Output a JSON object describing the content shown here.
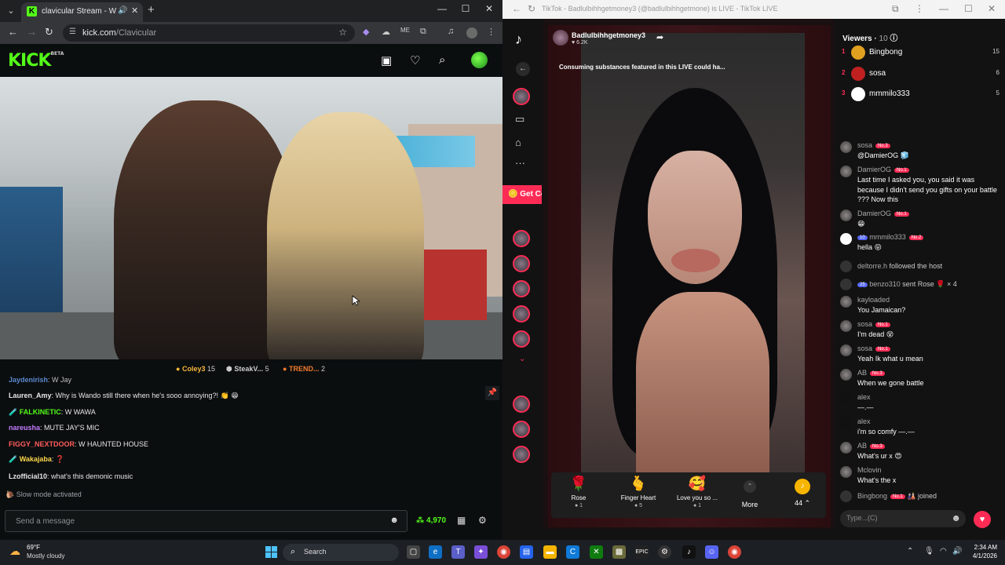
{
  "left": {
    "tab_title": "clavicular Stream - Watch L",
    "url_host": "kick.com",
    "url_path": "/Clavicular",
    "logo": "KICK",
    "logo_sup": "BETA",
    "viewers_bar": [
      {
        "icon": "coin",
        "name": "Coley3",
        "count": "15"
      },
      {
        "icon": "cube",
        "name": "SteakV...",
        "count": "5"
      },
      {
        "icon": "fire",
        "name": "TREND...",
        "count": "2"
      }
    ],
    "chat": [
      {
        "user": "Jaydenirish",
        "color": "#6fa8ff",
        "text": ": W Jay",
        "partial": true
      },
      {
        "user": "Lauren_Amy",
        "color": "#ffffff",
        "text": ": Why is Wando still there when he's sooo annoying?! 👏 😁"
      },
      {
        "user": "FALKINETIC",
        "color": "#53fc18",
        "text": ": W WAWA",
        "badge": true
      },
      {
        "user": "nareusha",
        "color": "#c37cff",
        "text": ": MUTE JAY'S MIC"
      },
      {
        "user": "FIGGY_NEXTDOOR",
        "color": "#ff5c5c",
        "text": ": W HAUNTED HOUSE"
      },
      {
        "user": "Wakajaba",
        "color": "#f9d64a",
        "text": ": ❓",
        "badge": true
      },
      {
        "user": "Lzofficial10",
        "color": "#ffffff",
        "text": ": what's this demonic music"
      }
    ],
    "slow_mode": "Slow mode activated",
    "send_placeholder": "Send a message",
    "points": "4,970"
  },
  "right": {
    "window_title": "TikTok - Badlulbihhgetmoney3 (@badlulbihhgetmone) is LIVE - TikTok LIVE",
    "get_coins": "Get Coins",
    "host_name": "Badlulbihhgetmoney3",
    "host_likes": "6.2K",
    "warning": "Consuming substances featured in this LIVE could ha...",
    "viewers_label": "Viewers",
    "viewers_count": "10",
    "ranking": [
      {
        "rank": "1",
        "name": "Bingbong",
        "score": "15",
        "color": "#e0a020"
      },
      {
        "rank": "2",
        "name": "sosa",
        "score": "6",
        "color": "#c02020"
      },
      {
        "rank": "3",
        "name": "mmmilo333",
        "score": "5",
        "color": "#ffffff"
      }
    ],
    "messages": [
      {
        "user": "sosa",
        "badge": "No.3",
        "text": "@DamierOG 🧊"
      },
      {
        "user": "DamierOG",
        "badge": "No.1",
        "text": "Last time I asked you, you said it was because I didn't send you gifts on your battle ??? Now this"
      },
      {
        "user": "DamierOG",
        "badge": "No.1",
        "text": "😁"
      },
      {
        "user": "mmmilo333",
        "level": "10",
        "badge": "No.2",
        "text": "hella 😝"
      },
      {
        "sys_user": "deltorre.h",
        "sys_text": "followed the host"
      },
      {
        "sys_user": "benzo310",
        "level": "25",
        "sys_text": "sent Rose 🌹 × 4"
      },
      {
        "user": "kayloaded",
        "text": "You Jamaican?"
      },
      {
        "user": "sosa",
        "badge": "No.1",
        "text": "I'm dead 😵"
      },
      {
        "user": "sosa",
        "badge": "No.1",
        "text": "Yeah Ik what u mean"
      },
      {
        "user": "AB",
        "badge": "No.3",
        "text": "When we gone battle"
      },
      {
        "user": "alex",
        "text": "—.—"
      },
      {
        "user": "alex",
        "text": "i'm so comfy —.—"
      },
      {
        "user": "AB",
        "badge": "No.3",
        "text": "What's ur x 😍"
      },
      {
        "user": "Mclovin",
        "text": "What's the x"
      },
      {
        "sys_user": "Bingbong",
        "badge": "No.1",
        "sys_text": "joined"
      }
    ],
    "gifts": [
      {
        "name": "Rose",
        "price": "1",
        "icon": "🌹"
      },
      {
        "name": "Finger Heart",
        "price": "5",
        "icon": "🫰"
      },
      {
        "name": "Love you so ...",
        "price": "1",
        "icon": "🥰"
      }
    ],
    "more": "More",
    "coins": "44",
    "input_placeholder": "Type...(C)"
  },
  "taskbar": {
    "temp": "69°F",
    "weather": "Mostly cloudy",
    "search": "Search",
    "time": "2:34 AM",
    "date": "4/1/2026"
  }
}
